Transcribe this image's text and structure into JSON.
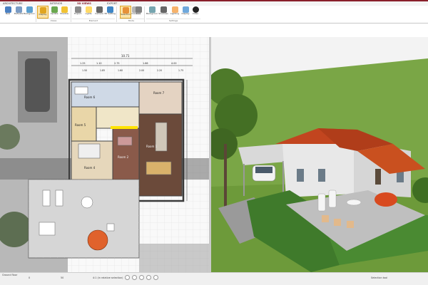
{
  "window": {
    "tabs": [
      {
        "label": "ARCHITECTURE",
        "active": false
      },
      {
        "label": "INTERIOR",
        "active": false
      },
      {
        "label": "3D VIEWS",
        "active": true
      },
      {
        "label": "EXPORT",
        "active": false
      }
    ]
  },
  "ribbon": {
    "buttons": [
      {
        "id": "new-project",
        "label": "New",
        "icon": "file-icon"
      },
      {
        "id": "defaults",
        "label": "Defaults",
        "icon": "settings-icon"
      },
      {
        "id": "background-image",
        "label": "Background image",
        "icon": "image-icon"
      },
      {
        "id": "display-all",
        "label": "Display",
        "icon": "eye-icon",
        "selected": true
      },
      {
        "id": "update",
        "label": "Update",
        "icon": "refresh-icon"
      },
      {
        "id": "shadow",
        "label": "Shadow",
        "icon": "sun-icon"
      },
      {
        "id": "export",
        "label": "Export",
        "icon": "export-icon"
      },
      {
        "id": "lights",
        "label": "Lights",
        "icon": "bulb-icon"
      },
      {
        "id": "camera-3d",
        "label": "Camera",
        "icon": "camera-icon"
      },
      {
        "id": "3d-settings",
        "label": "3D Settings",
        "icon": "cube-icon"
      },
      {
        "id": "draw",
        "label": "Draw",
        "icon": "pencil-icon"
      },
      {
        "id": "dimension",
        "label": "Dimension",
        "icon": "ruler-icon"
      },
      {
        "id": "selection",
        "label": "Selection",
        "icon": "cursor-icon",
        "selected": true
      },
      {
        "id": "area",
        "label": "Area",
        "icon": "area-icon"
      },
      {
        "id": "background",
        "label": "Background",
        "icon": "landscape-icon"
      },
      {
        "id": "shadows",
        "label": "Shadows",
        "icon": "shadow-icon"
      },
      {
        "id": "lighting",
        "label": "Lighting",
        "icon": "light-icon"
      },
      {
        "id": "display",
        "label": "Display",
        "icon": "monitor-icon"
      },
      {
        "id": "video",
        "label": "Video",
        "icon": "play-icon"
      }
    ],
    "groups": [
      "Views",
      "Element",
      "Mode",
      "Settings"
    ]
  },
  "plan": {
    "labels": [
      {
        "text": "Room 6",
        "key": "r6"
      },
      {
        "text": "Room 7",
        "key": "r7"
      },
      {
        "text": "Room 5",
        "key": "r5"
      },
      {
        "text": "Room 1",
        "key": "r1"
      },
      {
        "text": "Room 4",
        "key": "r4"
      },
      {
        "text": "Room 2",
        "key": "r2"
      }
    ],
    "dims_top": [
      "10.71",
      "1.25",
      "1.10",
      "2.75",
      "1.66",
      "4.00"
    ],
    "dims_top2": [
      "1.50",
      "1.85",
      "1.60",
      "2.00",
      "2.20",
      "1.75"
    ]
  },
  "status": {
    "left": "Ground floor",
    "floor_value": "0",
    "zoom": "50",
    "hint": "4:1 (in relative selection)",
    "right": "Selection tool"
  },
  "colors": {
    "accent": "#8a1f2b",
    "select": "#fbe4a8",
    "roof": "#c2451f",
    "lawn": "#5c8a2f",
    "sky": "#f4f4f4"
  }
}
